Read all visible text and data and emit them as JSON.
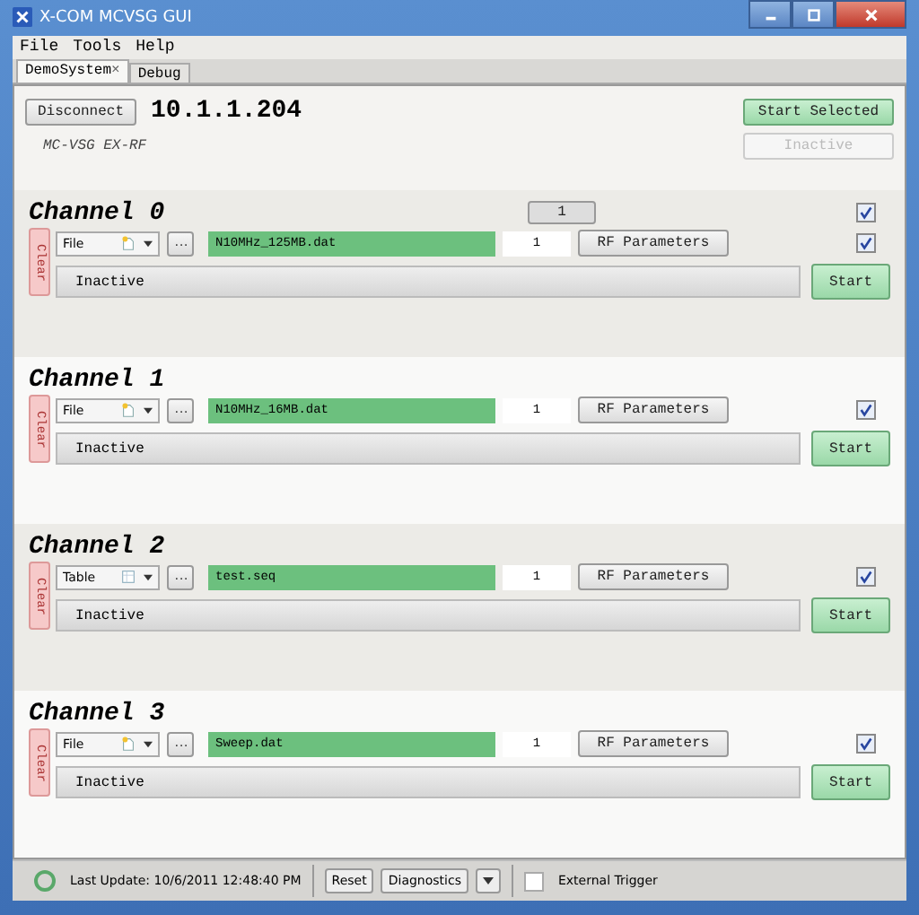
{
  "window": {
    "title": "X-COM MCVSG GUI"
  },
  "menu": [
    "File",
    "Tools",
    "Help"
  ],
  "tabs": [
    {
      "label": "DemoSystem",
      "close": "×",
      "selected": true
    },
    {
      "label": "Debug",
      "selected": false
    }
  ],
  "connection": {
    "button": "Disconnect",
    "address": "10.1.1.204",
    "device": "MC-VSG EX-RF",
    "start_selected": "Start Selected",
    "state": "Inactive",
    "state_disabled": true
  },
  "channels": [
    {
      "name": "Channel 0",
      "index_button": "1",
      "header_checked": true,
      "clear": "Clear",
      "source": {
        "label": "File",
        "kind": "file"
      },
      "browse": "...",
      "filename": "N10MHz_125MB.dat",
      "count": "1",
      "rf": "RF Parameters",
      "checked": true,
      "status": "Inactive",
      "start": "Start"
    },
    {
      "name": "Channel 1",
      "clear": "Clear",
      "source": {
        "label": "File",
        "kind": "file"
      },
      "browse": "...",
      "filename": "N10MHz_16MB.dat",
      "count": "1",
      "rf": "RF Parameters",
      "checked": true,
      "status": "Inactive",
      "start": "Start"
    },
    {
      "name": "Channel 2",
      "clear": "Clear",
      "source": {
        "label": "Table",
        "kind": "table"
      },
      "browse": "...",
      "filename": "test.seq",
      "count": "1",
      "rf": "RF Parameters",
      "checked": true,
      "status": "Inactive",
      "start": "Start"
    },
    {
      "name": "Channel 3",
      "clear": "Clear",
      "source": {
        "label": "File",
        "kind": "file"
      },
      "browse": "...",
      "filename": "Sweep.dat",
      "count": "1",
      "rf": "RF Parameters",
      "checked": true,
      "status": "Inactive",
      "start": "Start"
    }
  ],
  "status_bar": {
    "last_update": "Last Update: 10/6/2011 12:48:40 PM",
    "reset": "Reset",
    "diagnostics": "Diagnostics",
    "external_trigger": {
      "label": "External Trigger",
      "checked": false
    }
  }
}
